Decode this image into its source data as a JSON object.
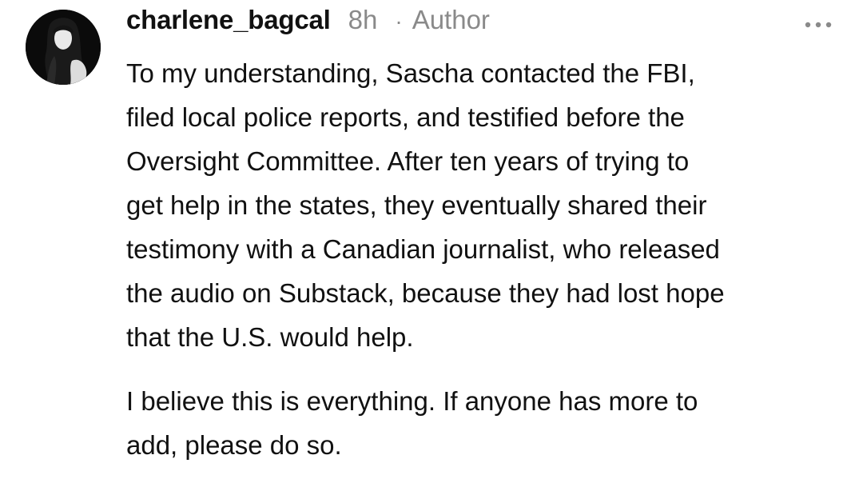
{
  "comment": {
    "username": "charlene_bagcal",
    "timestamp": "8h",
    "separator": "·",
    "author_badge": "Author",
    "more_icon": "more-horizontal-icon",
    "paragraphs": [
      "To my understanding, Sascha contacted the FBI,\nfiled local police reports, and testified before the\nOversight Committee. After ten years of trying to\nget help in the states, they eventually shared their\ntestimony with a Canadian journalist, who released\nthe audio on Substack, because they had lost hope\nthat the U.S. would help.",
      "I believe this is everything. If anyone has more to\nadd, please do so."
    ]
  },
  "colors": {
    "text": "#111111",
    "muted": "#8a8a8a",
    "background": "#ffffff",
    "avatar_bg": "#0d0d0d"
  }
}
